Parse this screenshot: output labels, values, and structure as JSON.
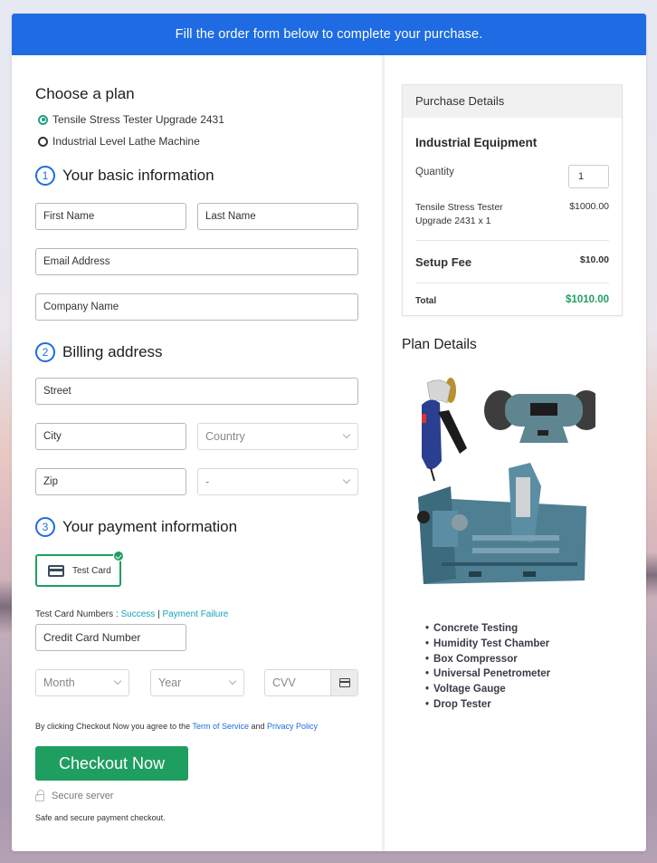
{
  "banner": {
    "text": "Fill the order form below to complete your purchase."
  },
  "plan": {
    "heading": "Choose a plan",
    "options": [
      {
        "label": "Tensile Stress Tester Upgrade 2431",
        "selected": true
      },
      {
        "label": "Industrial Level Lathe Machine",
        "selected": false
      }
    ]
  },
  "basic": {
    "number": "1",
    "title": "Your basic information",
    "first_name_placeholder": "First Name",
    "last_name_placeholder": "Last Name",
    "email_placeholder": "Email Address",
    "company_placeholder": "Company Name"
  },
  "billing": {
    "number": "2",
    "title": "Billing address",
    "street_placeholder": "Street",
    "city_placeholder": "City",
    "country_selected": "Country",
    "zip_placeholder": "Zip",
    "state_selected": "-"
  },
  "payment": {
    "number": "3",
    "title": "Your payment information",
    "method_label": "Test Card",
    "test_numbers_label": "Test Card Numbers :",
    "success_link": "Success",
    "separator": "|",
    "failure_link": "Payment Failure",
    "card_number_placeholder": "Credit Card Number",
    "month_selected": "Month",
    "year_selected": "Year",
    "cvv_placeholder": "CVV"
  },
  "footer": {
    "agree_prefix": "By clicking Checkout Now you agree to the",
    "terms_link": "Term of Service",
    "and": "and",
    "privacy_link": "Privacy Policy",
    "checkout_label": "Checkout Now",
    "secure_label": "Secure server",
    "safe_text": "Safe and secure payment checkout."
  },
  "purchase": {
    "header": "Purchase Details",
    "title": "Industrial Equipment",
    "quantity_label": "Quantity",
    "quantity_value": "1",
    "item_name": "Tensile Stress Tester Upgrade 2431 x 1",
    "item_price": "$1000.00",
    "setup_fee_label": "Setup Fee",
    "setup_fee_value": "$10.00",
    "total_label": "Total",
    "total_value": "$1010.00"
  },
  "plan_details": {
    "heading": "Plan Details",
    "image_alt": "Industrial equipment: angle grinder, bench grinder and CNC lathe",
    "features": [
      "Concrete Testing",
      "Humidity Test Chamber",
      "Box Compressor",
      "Universal Penetrometer",
      "Voltage Gauge",
      "Drop Tester"
    ]
  },
  "colors": {
    "banner": "#1e6be4",
    "accent_green": "#1f9e61",
    "radio_selected": "#20a182",
    "link_teal": "#17a2b8"
  }
}
